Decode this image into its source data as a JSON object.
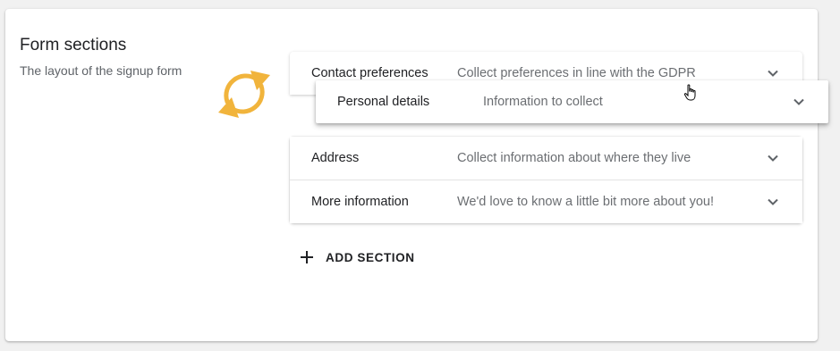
{
  "header": {
    "title": "Form sections",
    "subtitle": "The layout of the signup form"
  },
  "sections": [
    {
      "name": "Contact preferences",
      "description": "Collect preferences in line with the GDPR"
    },
    {
      "name": "Address",
      "description": "Collect information about where they live"
    },
    {
      "name": "More information",
      "description": "We'd love to know a little bit more about you!"
    }
  ],
  "dragging_section": {
    "name": "Personal details",
    "description": "Information to collect"
  },
  "actions": {
    "add_section_label": "ADD SECTION"
  },
  "icons": {
    "reorder": "sync-arrows-icon",
    "expand": "chevron-down-icon",
    "add": "plus-icon",
    "cursor": "hand-pointer-icon"
  },
  "colors": {
    "accent": "#f1b43c",
    "text_primary": "#202124",
    "text_secondary": "#6b6e72"
  }
}
